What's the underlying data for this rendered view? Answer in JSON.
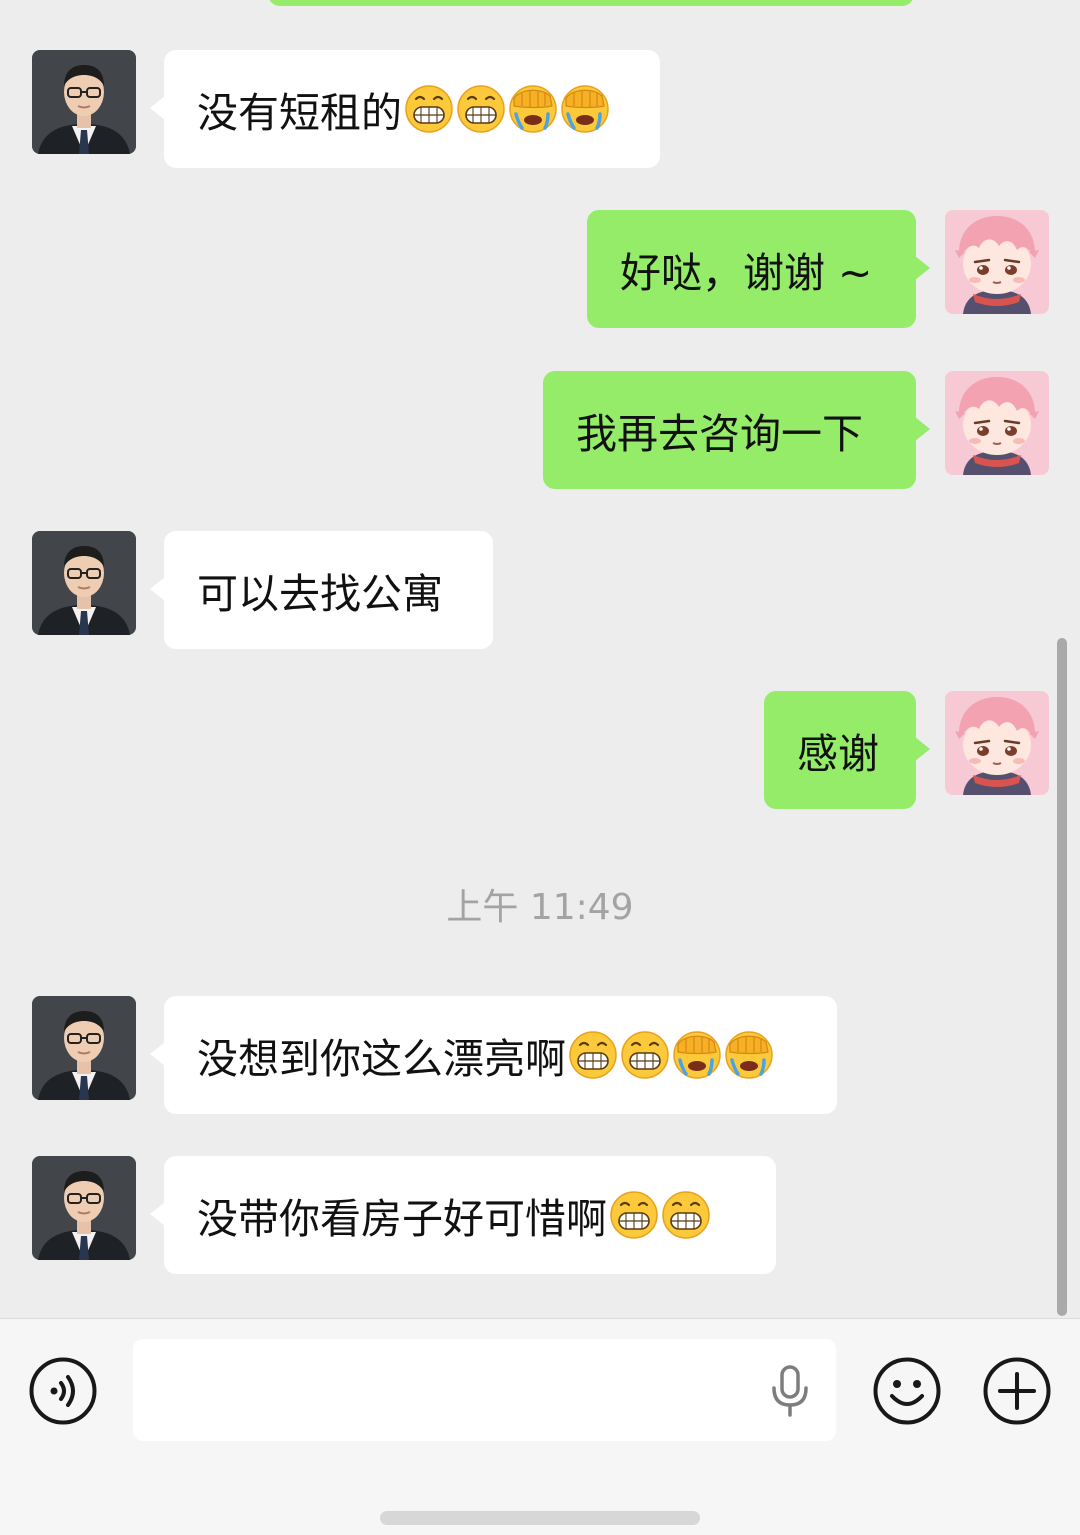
{
  "messages": [
    {
      "text": "没有短租的",
      "emojis": [
        "grin-emoji",
        "grin-emoji",
        "facepalm-cry-emoji",
        "facepalm-cry-emoji"
      ]
    },
    {
      "text": "好哒，谢谢 ~"
    },
    {
      "text": "我再去咨询一下"
    },
    {
      "text": "可以去找公寓"
    },
    {
      "text": "感谢"
    },
    {
      "text": "没想到你这么漂亮啊",
      "emojis": [
        "grin-emoji",
        "grin-emoji",
        "facepalm-cry-emoji",
        "facepalm-cry-emoji"
      ]
    },
    {
      "text": "没带你看房子好可惜啊",
      "emojis": [
        "grin-emoji",
        "grin-emoji"
      ]
    }
  ],
  "timestamp": "上午 11:49",
  "input": {
    "value": "",
    "placeholder": ""
  },
  "icons": [
    "voice-icon",
    "microphone-icon",
    "emoji-icon",
    "plus-icon"
  ],
  "colors": {
    "background": "#ededed",
    "outgoing_bubble": "#95ec69",
    "incoming_bubble": "#ffffff",
    "timestamp": "#a3a3a3"
  }
}
